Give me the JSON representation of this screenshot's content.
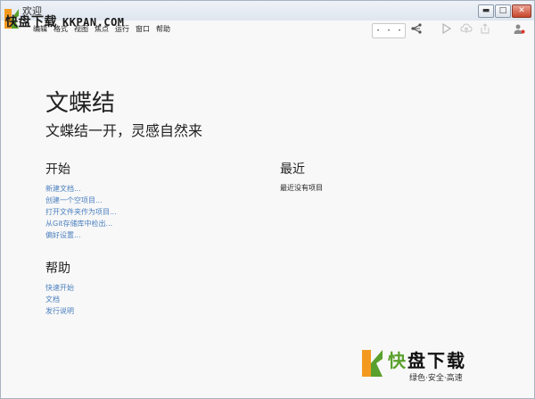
{
  "window": {
    "title": "欢迎",
    "controls": {
      "minimize": "▬",
      "maximize": "□",
      "close": "✕"
    }
  },
  "menu": [
    "编辑",
    "格式",
    "视图",
    "焦点",
    "运行",
    "窗口",
    "帮助"
  ],
  "toolbar": {
    "nav_dots": [
      "•",
      "•",
      "•"
    ],
    "icons": [
      "share-icon",
      "play-icon",
      "upload-icon",
      "export-icon",
      "user-alert-icon"
    ]
  },
  "main": {
    "app_name": "文蝶结",
    "slogan": "文蝶结一开，灵感自然来",
    "start": {
      "title": "开始",
      "links": [
        "新建文档...",
        "创建一个空项目...",
        "打开文件夹作为项目...",
        "从Git存储库中检出...",
        "偏好设置..."
      ]
    },
    "help": {
      "title": "帮助",
      "links": [
        "快速开始",
        "文档",
        "发行说明"
      ]
    },
    "recent": {
      "title": "最近",
      "empty_text": "最近没有项目"
    }
  },
  "watermark": {
    "top_cn": "快盘下载",
    "top_latin": "KKPAN.COM",
    "bottom_brand_first": "快",
    "bottom_brand_rest": "盘下载",
    "bottom_tagline": "绿色·安全·高速",
    "colors": {
      "orange": "#f39a1e",
      "green": "#5aa02c"
    }
  }
}
